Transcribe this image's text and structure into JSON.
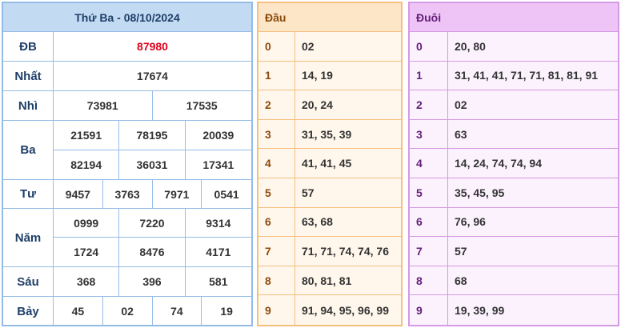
{
  "results": {
    "title": "Thứ Ba - 08/10/2024",
    "prizes": [
      {
        "label": "ĐB",
        "values": [
          "87980"
        ]
      },
      {
        "label": "Nhất",
        "values": [
          "17674"
        ]
      },
      {
        "label": "Nhì",
        "values": [
          "73981",
          "17535"
        ]
      },
      {
        "label": "Ba",
        "values": [
          "21591",
          "78195",
          "20039",
          "82194",
          "36031",
          "17341"
        ]
      },
      {
        "label": "Tư",
        "values": [
          "9457",
          "3763",
          "7971",
          "0541"
        ]
      },
      {
        "label": "Năm",
        "values": [
          "0999",
          "7220",
          "9314",
          "1724",
          "8476",
          "4171"
        ]
      },
      {
        "label": "Sáu",
        "values": [
          "368",
          "396",
          "581"
        ]
      },
      {
        "label": "Bảy",
        "values": [
          "45",
          "02",
          "74",
          "19"
        ]
      }
    ],
    "special_color": "#e0001b"
  },
  "dau": {
    "header": "Đầu",
    "rows": [
      {
        "key": "0",
        "value": "02"
      },
      {
        "key": "1",
        "value": "14, 19"
      },
      {
        "key": "2",
        "value": "20, 24"
      },
      {
        "key": "3",
        "value": "31, 35, 39"
      },
      {
        "key": "4",
        "value": "41, 41, 45"
      },
      {
        "key": "5",
        "value": "57"
      },
      {
        "key": "6",
        "value": "63, 68"
      },
      {
        "key": "7",
        "value": "71, 71, 74, 74, 76"
      },
      {
        "key": "8",
        "value": "80, 81, 81"
      },
      {
        "key": "9",
        "value": "91, 94, 95, 96, 99"
      }
    ]
  },
  "duoi": {
    "header": "Đuôi",
    "rows": [
      {
        "key": "0",
        "value": "20, 80"
      },
      {
        "key": "1",
        "value": "31, 41, 41, 71, 71, 81, 81, 91"
      },
      {
        "key": "2",
        "value": "02"
      },
      {
        "key": "3",
        "value": "63"
      },
      {
        "key": "4",
        "value": "14, 24, 74, 74, 94"
      },
      {
        "key": "5",
        "value": "35, 45, 95"
      },
      {
        "key": "6",
        "value": "76, 96"
      },
      {
        "key": "7",
        "value": "57"
      },
      {
        "key": "8",
        "value": "68"
      },
      {
        "key": "9",
        "value": "19, 39, 99"
      }
    ]
  }
}
